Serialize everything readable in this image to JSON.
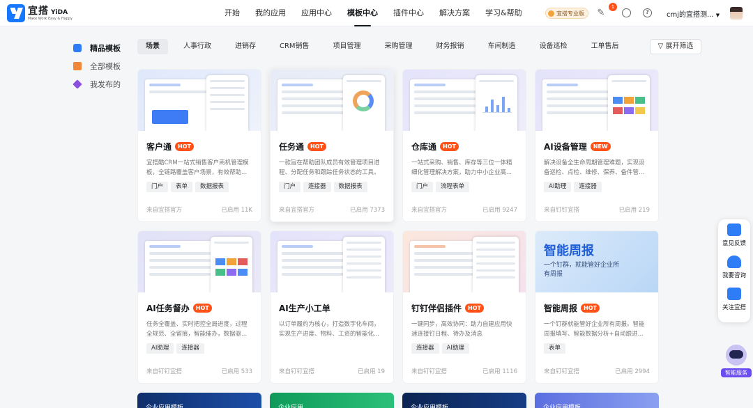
{
  "header": {
    "logo_cn": "宜搭",
    "logo_en": "YiDA",
    "logo_sub": "Make Work Easy & Happy",
    "nav": [
      "开始",
      "我的应用",
      "应用中心",
      "模板中心",
      "插件中心",
      "解决方案",
      "学习&帮助"
    ],
    "active_nav": "模板中心",
    "pro_badge": "宜搭专业版",
    "notification_count": "1",
    "user_name": "cmj的宜搭测...",
    "help_glyph": "?"
  },
  "sidebar": {
    "items": [
      {
        "label": "精品模板",
        "icon": "puzzle-icon",
        "color": "#2e7cf6"
      },
      {
        "label": "全部模板",
        "icon": "gift-icon",
        "color": "#f2873a"
      },
      {
        "label": "我发布的",
        "icon": "layers-icon",
        "color": "#8b4fe0"
      }
    ]
  },
  "filters": {
    "chips": [
      "场景",
      "人事行政",
      "进销存",
      "CRM销售",
      "项目管理",
      "采购管理",
      "财务报销",
      "车间制造",
      "设备巡检",
      "工单售后"
    ],
    "expand_label": "展开筛选"
  },
  "cards": [
    {
      "title": "客户通",
      "badge": "HOT",
      "desc": "宜搭酷CRM一站式销售客户商机管理模板，全链路覆盖客户场景，有效帮助...",
      "tags": [
        "门户",
        "表单",
        "数据报表"
      ],
      "source": "来自宜搭官方",
      "used": "已启用 11K"
    },
    {
      "title": "任务通",
      "badge": "HOT",
      "desc": "一款旨在帮助团队成员有效管理项目进程、分配任务和跟踪任务状态的工具。",
      "tags": [
        "门户",
        "连接器",
        "数据报表"
      ],
      "source": "来自宜搭官方",
      "used": "已启用 7373"
    },
    {
      "title": "仓库通",
      "badge": "HOT",
      "desc": "一站式采购、销售、库存等三位一体精细化管理解决方案，助力中小企业高...",
      "tags": [
        "门户",
        "流程表单"
      ],
      "source": "来自宜搭官方",
      "used": "已启用 9247"
    },
    {
      "title": "AI设备管理",
      "badge": "NEW",
      "desc": "解决设备全生命周期管理难题，实现设备巡检、点检、维修、保养、备件管...",
      "tags": [
        "AI助理",
        "连接器"
      ],
      "source": "来自钉钉宜搭",
      "used": "已启用 219"
    },
    {
      "title": "AI任务督办",
      "badge": "HOT",
      "desc": "任务全覆盖、实时把控全局进度，过程全规范、全留痕，智能催办，数据驱...",
      "tags": [
        "AI助理",
        "连接器"
      ],
      "source": "来自钉钉宜搭",
      "used": "已启用 533"
    },
    {
      "title": "AI生产小工单",
      "badge": "",
      "desc": "以订单履约为核心，打造数字化车间，实现生产进度、物料、工资的智能化...",
      "tags": [],
      "source": "来自钉钉宜搭",
      "used": "已启用 19"
    },
    {
      "title": "钉钉伴侣插件",
      "badge": "HOT",
      "desc": "一键同步，高效协同：助力自建应用快速连接钉日程、待办及消息",
      "tags": [
        "连接器",
        "AI助理"
      ],
      "source": "来自钉钉宜搭",
      "used": "已启用 1116"
    },
    {
      "title": "智能周报",
      "badge": "HOT",
      "desc": "一个钉群就能管好企业所有周报。智能周报填写、智能数据分析+自动跟进...",
      "tags": [
        "表单"
      ],
      "source": "来自钉钉宜搭",
      "used": "已启用 2994",
      "promo_title": "智能周报",
      "promo_sub": "一个钉群，就能管好企业所有周报"
    }
  ],
  "bottom_cards": [
    "企业应用模板",
    "企业应用",
    "企业应用模板",
    "企业应用模板"
  ],
  "float_panel": [
    "意见反馈",
    "我要咨询",
    "关注宜搭"
  ],
  "ai_service": "智能服务"
}
